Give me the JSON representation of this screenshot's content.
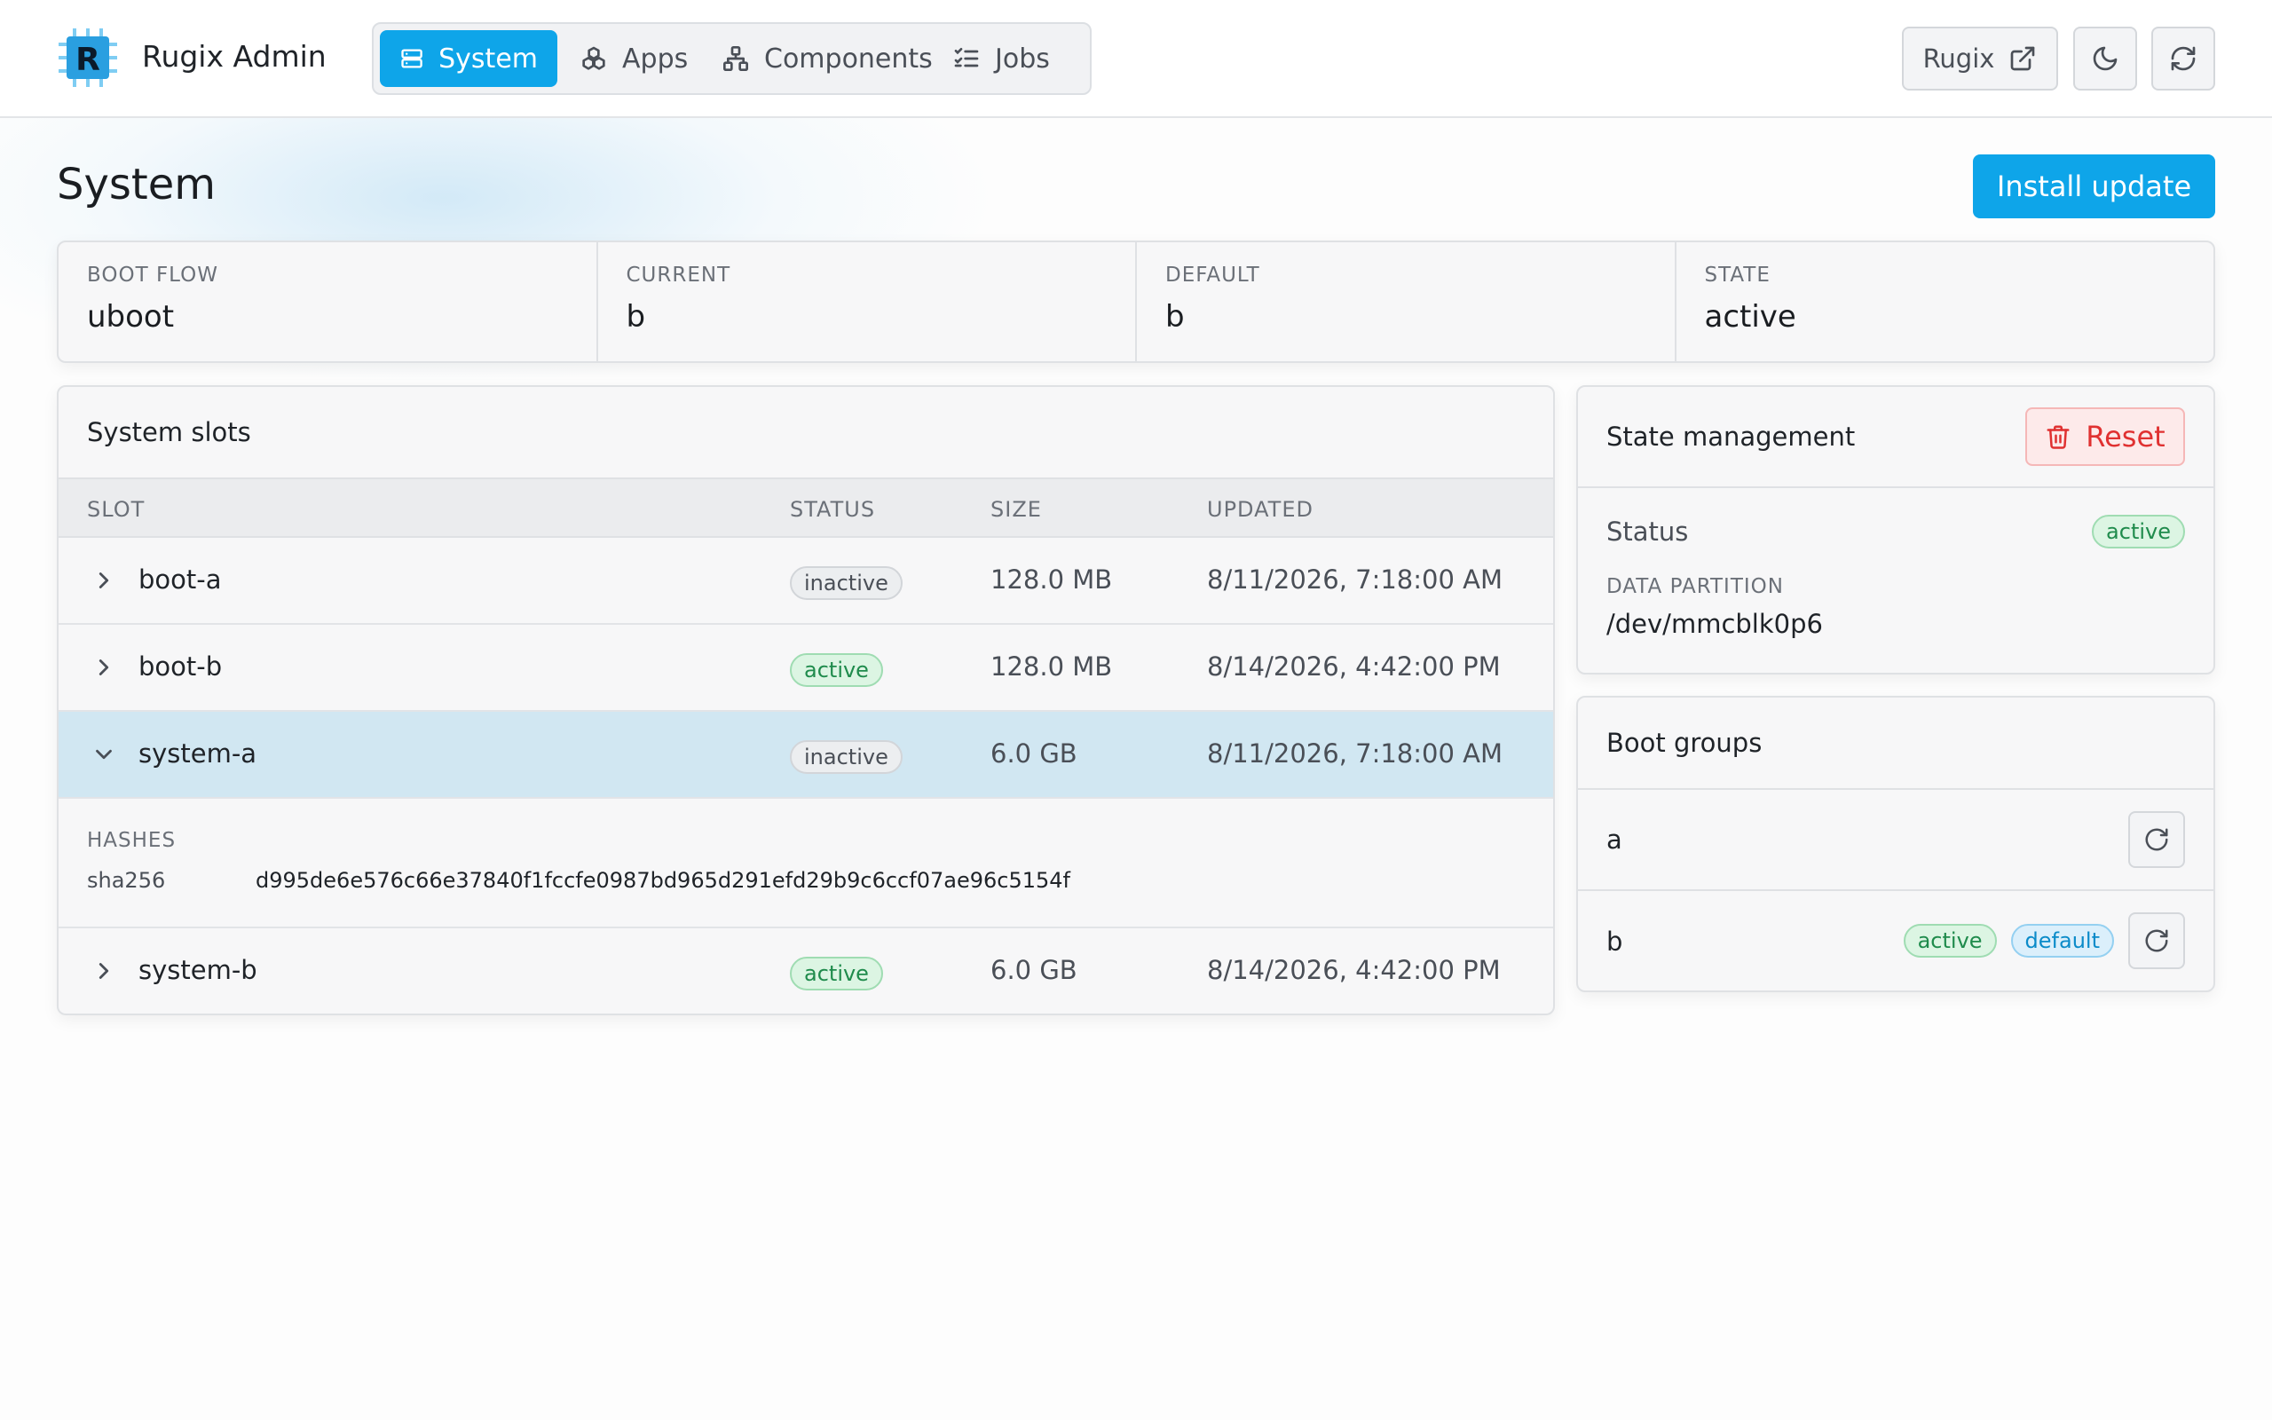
{
  "app": {
    "title": "Rugix Admin"
  },
  "nav": [
    {
      "label": "System",
      "icon": "server-icon",
      "active": true
    },
    {
      "label": "Apps",
      "icon": "boxes-icon",
      "active": false
    },
    {
      "label": "Components",
      "icon": "network-icon",
      "active": false
    },
    {
      "label": "Jobs",
      "icon": "list-checks-icon",
      "active": false
    }
  ],
  "header_actions": {
    "rugix_label": "Rugix"
  },
  "page": {
    "title": "System",
    "install_label": "Install update"
  },
  "stats": [
    {
      "label": "BOOT FLOW",
      "value": "uboot"
    },
    {
      "label": "CURRENT",
      "value": "b"
    },
    {
      "label": "DEFAULT",
      "value": "b"
    },
    {
      "label": "STATE",
      "value": "active"
    }
  ],
  "slots": {
    "title": "System slots",
    "columns": {
      "slot": "SLOT",
      "status": "STATUS",
      "size": "SIZE",
      "updated": "UPDATED"
    },
    "rows": [
      {
        "name": "boot-a",
        "status": "inactive",
        "size": "128.0 MB",
        "updated": "8/11/2026, 7:18:00 AM",
        "expanded": false
      },
      {
        "name": "boot-b",
        "status": "active",
        "size": "128.0 MB",
        "updated": "8/14/2026, 4:42:00 PM",
        "expanded": false
      },
      {
        "name": "system-a",
        "status": "inactive",
        "size": "6.0 GB",
        "updated": "8/11/2026, 7:18:00 AM",
        "expanded": true
      },
      {
        "name": "system-b",
        "status": "active",
        "size": "6.0 GB",
        "updated": "8/14/2026, 4:42:00 PM",
        "expanded": false
      }
    ],
    "hashes": {
      "label": "HASHES",
      "algo": "sha256",
      "value": "d995de6e576c66e37840f1fccfe0987bd965d291efd29b9c6ccf07ae96c5154f"
    }
  },
  "state_mgmt": {
    "title": "State management",
    "reset_label": "Reset",
    "status_label": "Status",
    "status_value": "active",
    "partition_label": "DATA PARTITION",
    "partition_value": "/dev/mmcblk0p6"
  },
  "boot_groups": {
    "title": "Boot groups",
    "groups": [
      {
        "name": "a",
        "badges": []
      },
      {
        "name": "b",
        "badges": [
          "active",
          "default"
        ]
      }
    ]
  },
  "colors": {
    "accent": "#0ea5e9",
    "active": "#1f8b4c",
    "danger": "#e03131"
  }
}
